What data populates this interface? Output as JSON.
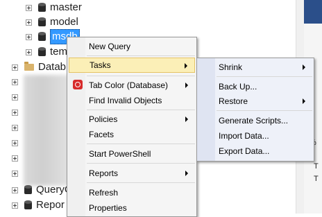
{
  "tree": {
    "nodes": [
      {
        "label": "master"
      },
      {
        "label": "model"
      },
      {
        "label": "msdb"
      },
      {
        "label": "tem"
      }
    ],
    "folder_label": "Datab",
    "bottom_nodes": [
      {
        "label": "QueryC"
      },
      {
        "label": "Repor"
      }
    ]
  },
  "right_pane": {
    "fragment_percent": "8 %",
    "fragment_t1": "T",
    "fragment_t2": "T"
  },
  "context_menu": {
    "items": [
      {
        "label": "New Query"
      },
      {
        "label": "Tasks"
      },
      {
        "label": "Tab Color (Database)"
      },
      {
        "label": "Find Invalid Objects"
      },
      {
        "label": "Policies"
      },
      {
        "label": "Facets"
      },
      {
        "label": "Start PowerShell"
      },
      {
        "label": "Reports"
      },
      {
        "label": "Refresh"
      },
      {
        "label": "Properties"
      }
    ],
    "tab_color_icon_color": "#d72b2b"
  },
  "tasks_submenu": {
    "items": [
      {
        "label": "Shrink"
      },
      {
        "label": "Back Up..."
      },
      {
        "label": "Restore"
      },
      {
        "label": "Generate Scripts..."
      },
      {
        "label": "Import Data..."
      },
      {
        "label": "Export Data..."
      }
    ]
  },
  "colors": {
    "selection": "#3399ff",
    "menu_highlight": "#fbefb7",
    "menu_highlight_border": "#e5c365"
  }
}
